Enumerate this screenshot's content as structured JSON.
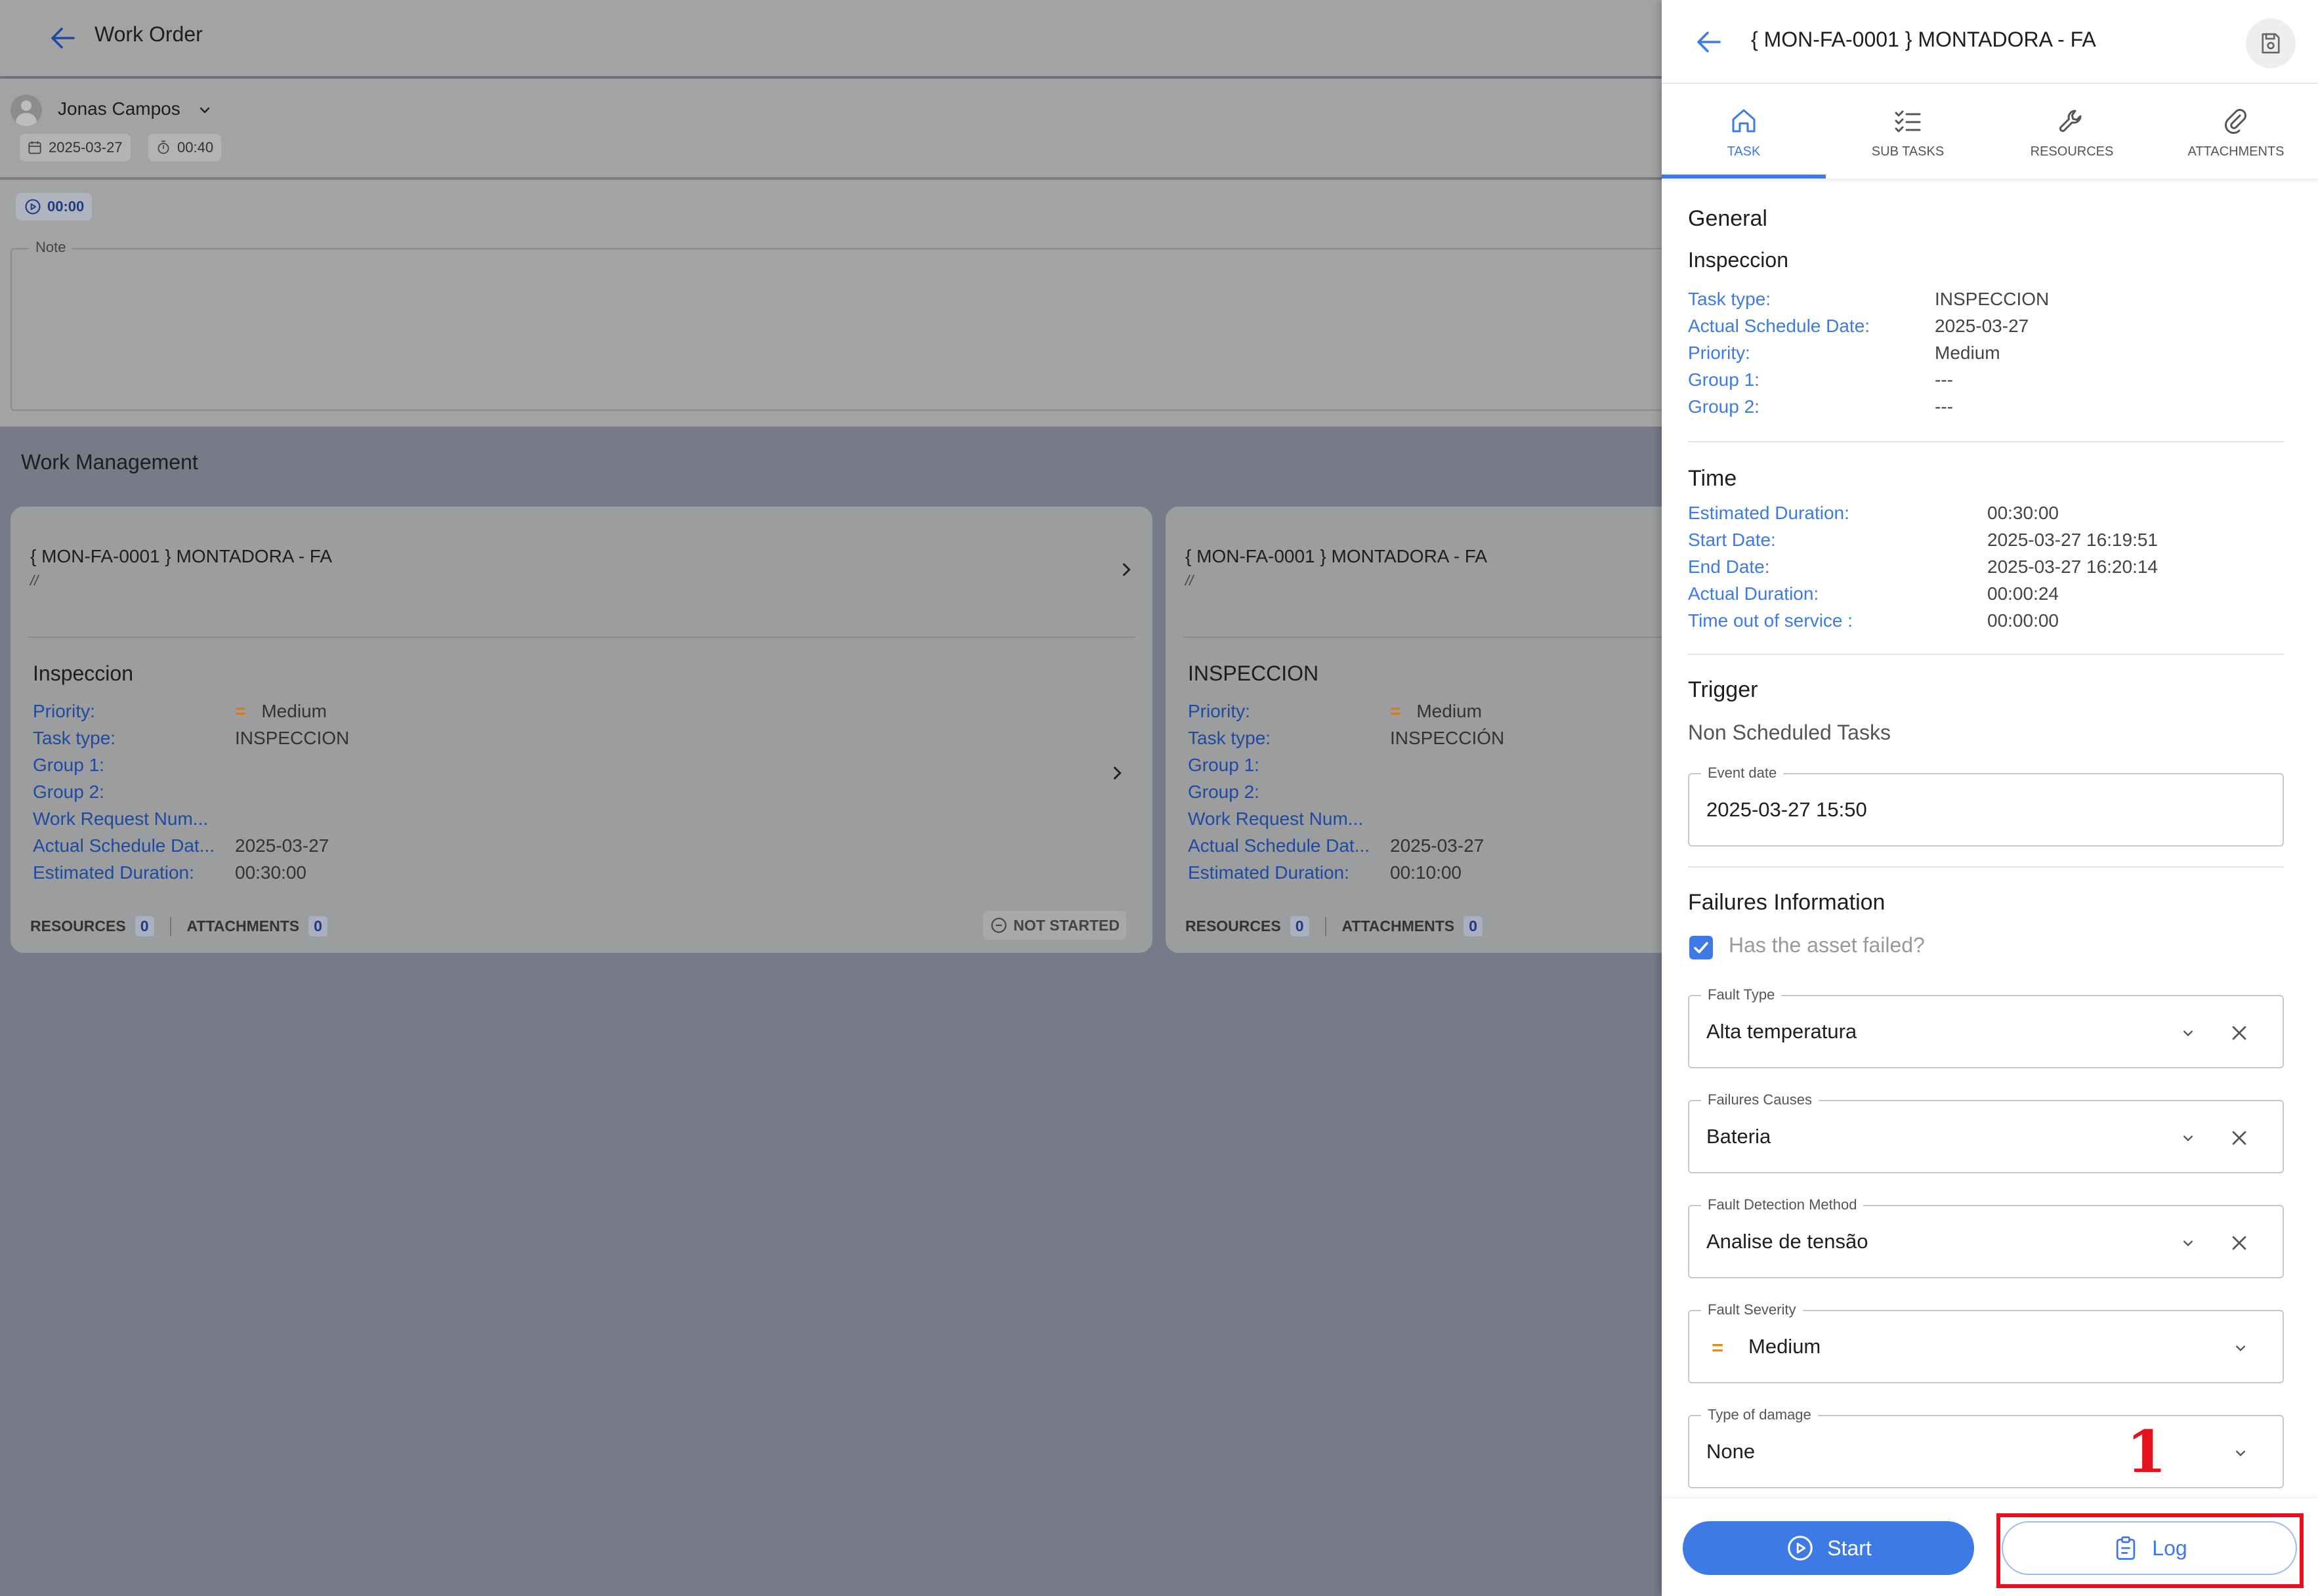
{
  "background": {
    "header": {
      "title": "Work Order"
    },
    "user": {
      "name": "Jonas Campos",
      "date": "2025-03-27",
      "duration": "00:40"
    },
    "timer": "00:00",
    "note_label": "Note",
    "section_title": "Work Management",
    "cards": [
      {
        "title": "{ MON-FA-0001 } MONTADORA - FA",
        "subtitle": "//",
        "task_name": "Inspeccion",
        "rows": [
          {
            "k": "Priority:",
            "v": "Medium",
            "priority": "="
          },
          {
            "k": "Task type:",
            "v": "INSPECCION"
          },
          {
            "k": "Group 1:",
            "v": ""
          },
          {
            "k": "Group 2:",
            "v": ""
          },
          {
            "k": "Work Request Num...",
            "v": ""
          },
          {
            "k": "Actual Schedule Dat...",
            "v": "2025-03-27"
          },
          {
            "k": "Estimated Duration:",
            "v": "00:30:00"
          }
        ],
        "resources_label": "RESOURCES",
        "resources_count": "0",
        "attachments_label": "ATTACHMENTS",
        "attachments_count": "0",
        "status": "NOT STARTED"
      },
      {
        "title": "{ MON-FA-0001 } MONTADORA - FA",
        "subtitle": "//",
        "task_name": "INSPECCION",
        "rows": [
          {
            "k": "Priority:",
            "v": "Medium",
            "priority": "="
          },
          {
            "k": "Task type:",
            "v": "INSPECCIÓN"
          },
          {
            "k": "Group 1:",
            "v": ""
          },
          {
            "k": "Group 2:",
            "v": ""
          },
          {
            "k": "Work Request Num...",
            "v": ""
          },
          {
            "k": "Actual Schedule Dat...",
            "v": "2025-03-27"
          },
          {
            "k": "Estimated Duration:",
            "v": "00:10:00"
          }
        ],
        "resources_label": "RESOURCES",
        "resources_count": "0",
        "attachments_label": "ATTACHMENTS",
        "attachments_count": "0"
      }
    ]
  },
  "panel": {
    "title": "{ MON-FA-0001 } MONTADORA - FA",
    "tabs": [
      {
        "label": "TASK",
        "icon": "home-icon"
      },
      {
        "label": "SUB TASKS",
        "icon": "checklist-icon"
      },
      {
        "label": "RESOURCES",
        "icon": "wrench-icon"
      },
      {
        "label": "ATTACHMENTS",
        "icon": "paperclip-icon"
      }
    ],
    "general": {
      "title": "General",
      "task_name": "Inspeccion",
      "rows": [
        {
          "k": "Task type:",
          "v": "INSPECCION"
        },
        {
          "k": "Actual Schedule Date:",
          "v": "2025-03-27"
        },
        {
          "k": "Priority:",
          "v": "Medium"
        },
        {
          "k": "Group 1:",
          "v": "---"
        },
        {
          "k": "Group 2:",
          "v": "---"
        }
      ]
    },
    "time": {
      "title": "Time",
      "rows": [
        {
          "k": "Estimated Duration:",
          "v": "00:30:00"
        },
        {
          "k": "Start Date:",
          "v": "2025-03-27 16:19:51"
        },
        {
          "k": "End Date:",
          "v": "2025-03-27 16:20:14"
        },
        {
          "k": "Actual Duration:",
          "v": "00:00:24"
        },
        {
          "k": "Time out of service :",
          "v": "00:00:00"
        }
      ]
    },
    "trigger": {
      "title": "Trigger",
      "subtitle": "Non Scheduled Tasks",
      "event_label": "Event date",
      "event_value": "2025-03-27 15:50"
    },
    "failures": {
      "title": "Failures Information",
      "checkbox_label": "Has the asset failed?",
      "fields": [
        {
          "label": "Fault Type",
          "value": "Alta temperatura"
        },
        {
          "label": "Failures Causes",
          "value": "Bateria"
        },
        {
          "label": "Fault Detection Method",
          "value": "Analise de tensão"
        },
        {
          "label": "Fault Severity",
          "value": "Medium",
          "severity_mark": "="
        },
        {
          "label": "Type of damage",
          "value": "None"
        }
      ]
    },
    "footer": {
      "start_label": "Start",
      "log_label": "Log"
    }
  },
  "annotation": {
    "marker": "1",
    "color": "#e5121e"
  },
  "colors": {
    "accent": "#3d7ae6",
    "priority_medium": "#e08a1e"
  }
}
